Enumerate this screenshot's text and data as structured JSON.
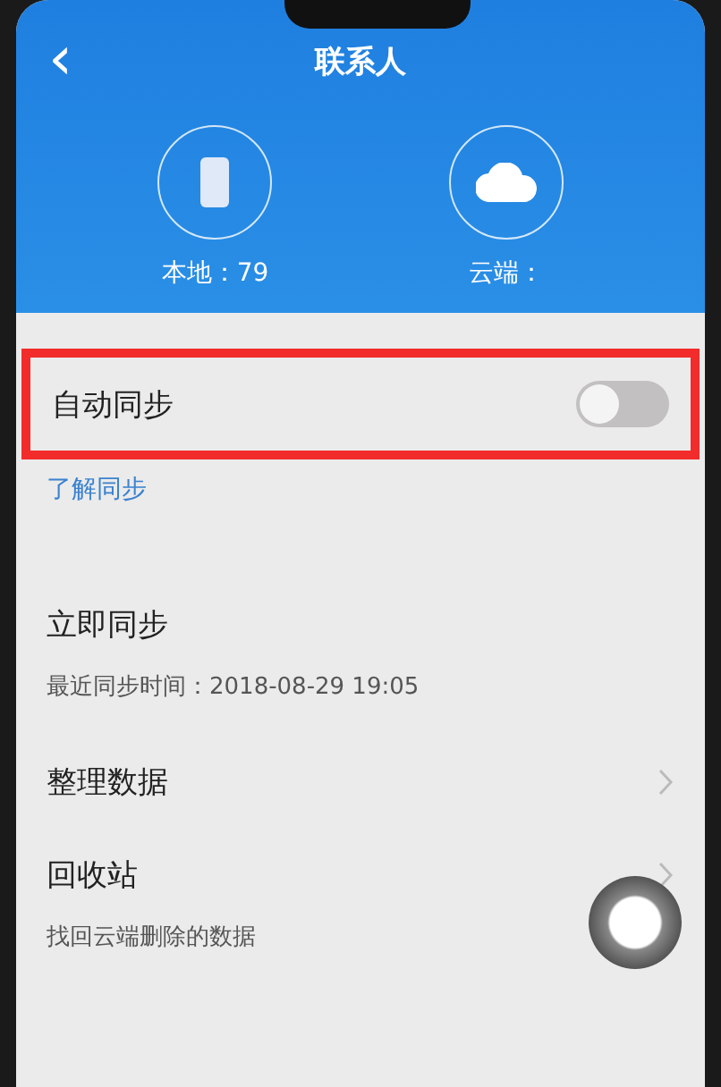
{
  "header": {
    "title": "联系人",
    "back": "‹"
  },
  "stats": [
    {
      "kind": "phone",
      "label": "本地：79"
    },
    {
      "kind": "cloud",
      "label": "云端："
    }
  ],
  "auto_sync": {
    "label": "自动同步",
    "on": false,
    "highlighted": true,
    "link": "了解同步"
  },
  "items": [
    {
      "kind": "sub",
      "title": "立即同步",
      "subtitle": "最近同步时间：2018-08-29 19:05",
      "chevron": false
    },
    {
      "kind": "plain",
      "title": "整理数据",
      "chevron": true
    },
    {
      "kind": "sub",
      "title": "回收站",
      "subtitle": "找回云端删除的数据",
      "chevron": true
    }
  ],
  "floating_button": {
    "visible": true
  }
}
